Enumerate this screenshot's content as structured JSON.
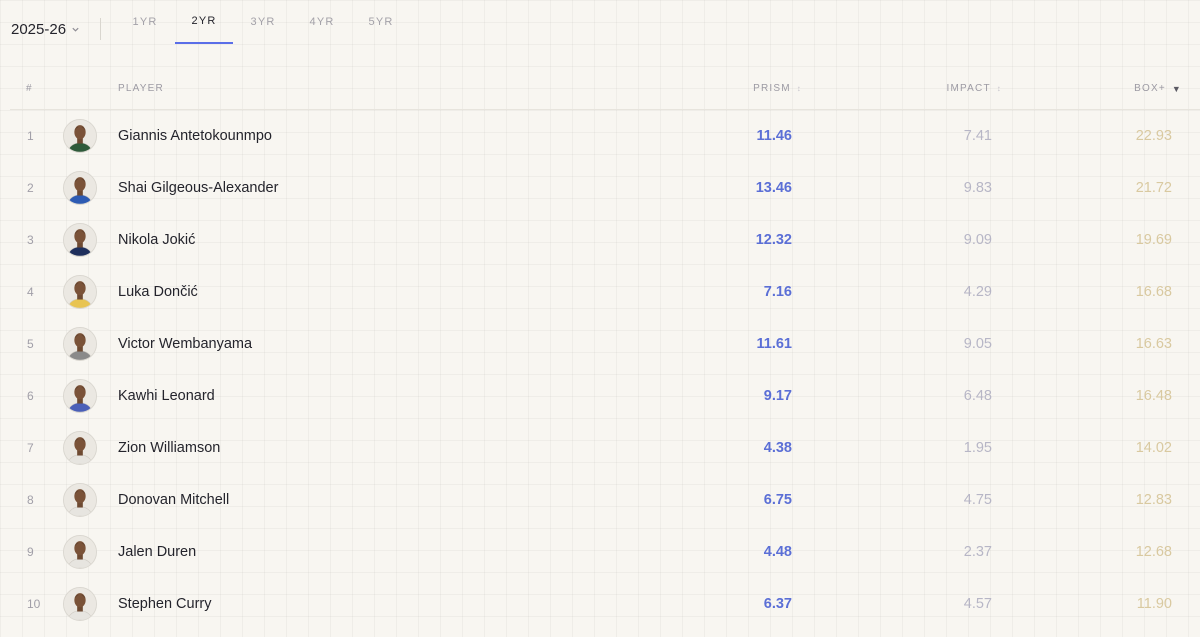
{
  "season": {
    "label": "2025-26"
  },
  "tabs": [
    {
      "label": "1YR"
    },
    {
      "label": "2YR"
    },
    {
      "label": "3YR"
    },
    {
      "label": "4YR"
    },
    {
      "label": "5YR"
    }
  ],
  "active_tab_index": 1,
  "columns": {
    "rank": "#",
    "player": "PLAYER",
    "prism": "PRISM",
    "impact": "IMPACT",
    "boxplus": "BOX+",
    "sorted_by": "BOX+",
    "sort_direction": "descending"
  },
  "colors": {
    "accent": "#5a6ee8",
    "prism": "#5b6fd6",
    "impact": "#b7b6c6",
    "boxplus": "#d9c9a0",
    "background": "#f8f6f1"
  },
  "rows": [
    {
      "rank": "1",
      "player": "Giannis Antetokounmpo",
      "prism": "11.46",
      "impact": "7.41",
      "boxplus": "22.93",
      "jersey": "#2e5a3a"
    },
    {
      "rank": "2",
      "player": "Shai Gilgeous-Alexander",
      "prism": "13.46",
      "impact": "9.83",
      "boxplus": "21.72",
      "jersey": "#2d5bb3"
    },
    {
      "rank": "3",
      "player": "Nikola Jokić",
      "prism": "12.32",
      "impact": "9.09",
      "boxplus": "19.69",
      "jersey": "#1e2f5c"
    },
    {
      "rank": "4",
      "player": "Luka Dončić",
      "prism": "7.16",
      "impact": "4.29",
      "boxplus": "16.68",
      "jersey": "#e8c452"
    },
    {
      "rank": "5",
      "player": "Victor Wembanyama",
      "prism": "11.61",
      "impact": "9.05",
      "boxplus": "16.63",
      "jersey": "#8a8a8a"
    },
    {
      "rank": "6",
      "player": "Kawhi Leonard",
      "prism": "9.17",
      "impact": "6.48",
      "boxplus": "16.48",
      "jersey": "#4a5fb8"
    },
    {
      "rank": "7",
      "player": "Zion Williamson",
      "prism": "4.38",
      "impact": "1.95",
      "boxplus": "14.02",
      "jersey": "#e7e5e0"
    },
    {
      "rank": "8",
      "player": "Donovan Mitchell",
      "prism": "6.75",
      "impact": "4.75",
      "boxplus": "12.83",
      "jersey": "#e7e5e0"
    },
    {
      "rank": "9",
      "player": "Jalen Duren",
      "prism": "4.48",
      "impact": "2.37",
      "boxplus": "12.68",
      "jersey": "#e7e5e0"
    },
    {
      "rank": "10",
      "player": "Stephen Curry",
      "prism": "6.37",
      "impact": "4.57",
      "boxplus": "11.90",
      "jersey": "#e7e5e0"
    }
  ]
}
